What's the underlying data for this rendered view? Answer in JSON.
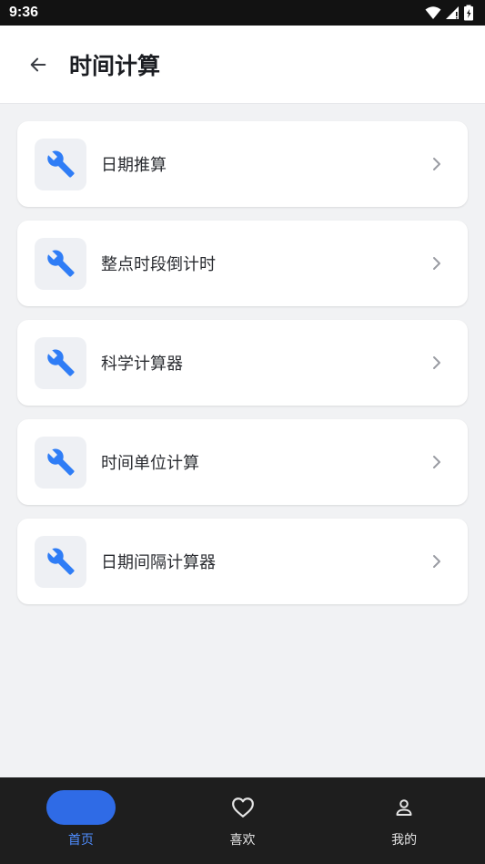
{
  "status_bar": {
    "time": "9:36"
  },
  "header": {
    "title": "时间计算"
  },
  "items": [
    {
      "label": "日期推算",
      "icon": "wrench-icon"
    },
    {
      "label": "整点时段倒计时",
      "icon": "wrench-icon"
    },
    {
      "label": "科学计算器",
      "icon": "wrench-icon"
    },
    {
      "label": "时间单位计算",
      "icon": "wrench-icon"
    },
    {
      "label": "日期间隔计算器",
      "icon": "wrench-icon"
    }
  ],
  "bottom_nav": [
    {
      "label": "首页",
      "icon": "home-icon",
      "active": true
    },
    {
      "label": "喜欢",
      "icon": "heart-icon",
      "active": false
    },
    {
      "label": "我的",
      "icon": "person-icon",
      "active": false
    }
  ],
  "colors": {
    "accent": "#2f6be6",
    "icon_blue": "#2f7df6",
    "background": "#f1f2f4",
    "nav_background": "#1e1e1e"
  }
}
